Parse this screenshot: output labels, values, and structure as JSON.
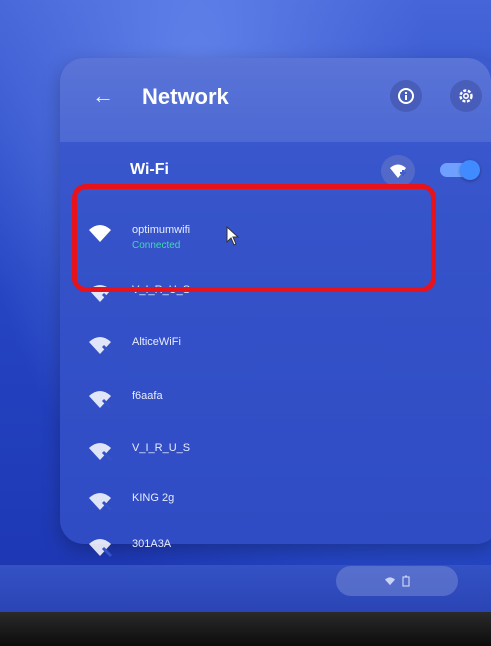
{
  "header": {
    "title": "Network"
  },
  "wifi": {
    "label": "Wi-Fi",
    "enabled": true
  },
  "networks": [
    {
      "name": "optimumwifi",
      "status": "Connected"
    },
    {
      "name": "V_I_R_U_S",
      "status": ""
    },
    {
      "name": "AlticeWiFi",
      "status": ""
    },
    {
      "name": "f6aafa",
      "status": ""
    },
    {
      "name": "V_I_R_U_S",
      "status": ""
    },
    {
      "name": "KING 2g",
      "status": ""
    },
    {
      "name": "301A3A",
      "status": ""
    }
  ],
  "icons": {
    "back": "back-arrow-icon",
    "info": "info-icon",
    "settings": "gear-icon",
    "add_wifi": "add-wifi-icon",
    "wifi": "wifi-icon",
    "cursor": "mouse-pointer-icon"
  },
  "colors": {
    "connected": "#44d6b3",
    "highlight": "#e8121a",
    "toggle": "#3f8bff"
  }
}
